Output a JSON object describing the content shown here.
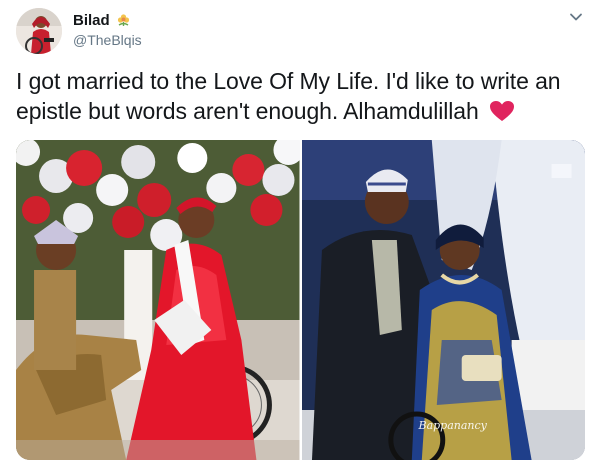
{
  "user": {
    "display_name": "Bilad",
    "handle": "@TheBlqis",
    "name_emoji": "sparkle-flower-icon"
  },
  "tweet": {
    "text": "I got married to the Love Of My Life. I'd like to write an epistle but words aren't enough. Alhamdulillah",
    "trailing_emoji": "red-heart-icon"
  },
  "media": {
    "photos": [
      {
        "name": "bride-proposal-photo"
      },
      {
        "name": "couple-portrait-photo",
        "watermark": "Bappanancy"
      }
    ]
  },
  "colors": {
    "heart": "#e0245e",
    "handle_gray": "#657786",
    "text": "#14171a"
  }
}
